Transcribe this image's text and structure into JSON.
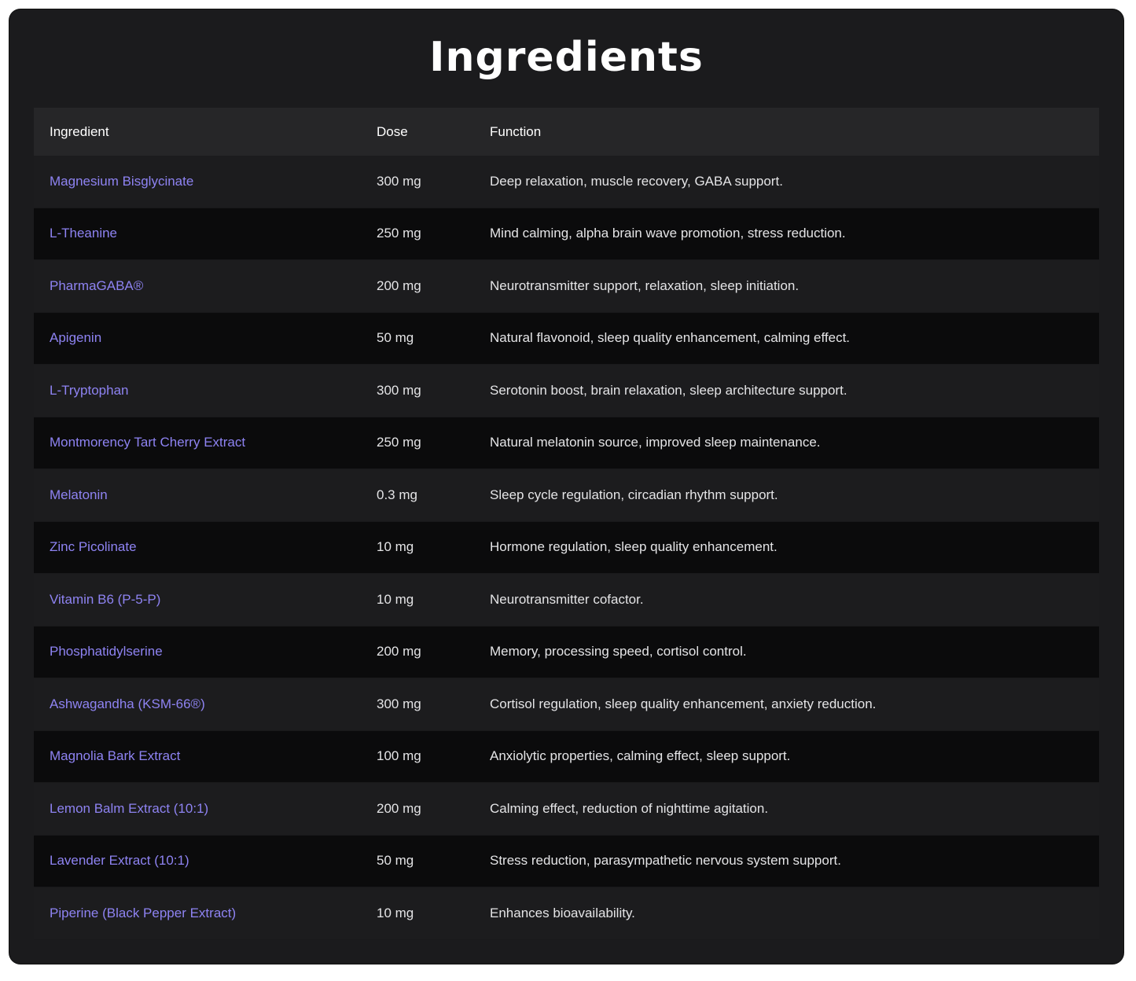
{
  "title": "Ingredients",
  "colors": {
    "card_background": "#1b1b1d",
    "header_background": "#262628",
    "ingredient_link": "#8e83f2",
    "text": "#e4e4e6"
  },
  "table": {
    "headers": [
      "Ingredient",
      "Dose",
      "Function"
    ],
    "rows": [
      {
        "ingredient": "Magnesium Bisglycinate",
        "dose": "300 mg",
        "function": "Deep relaxation, muscle recovery, GABA support."
      },
      {
        "ingredient": "L-Theanine",
        "dose": "250 mg",
        "function": "Mind calming, alpha brain wave promotion, stress reduction."
      },
      {
        "ingredient": "PharmaGABA®",
        "dose": "200 mg",
        "function": "Neurotransmitter support, relaxation, sleep initiation."
      },
      {
        "ingredient": "Apigenin",
        "dose": "50 mg",
        "function": "Natural flavonoid, sleep quality enhancement, calming effect."
      },
      {
        "ingredient": "L-Tryptophan",
        "dose": "300 mg",
        "function": "Serotonin boost, brain relaxation, sleep architecture support."
      },
      {
        "ingredient": "Montmorency Tart Cherry Extract",
        "dose": "250 mg",
        "function": "Natural melatonin source, improved sleep maintenance."
      },
      {
        "ingredient": "Melatonin",
        "dose": "0.3 mg",
        "function": "Sleep cycle regulation, circadian rhythm support."
      },
      {
        "ingredient": "Zinc Picolinate",
        "dose": "10 mg",
        "function": "Hormone regulation, sleep quality enhancement."
      },
      {
        "ingredient": "Vitamin B6 (P-5-P)",
        "dose": "10 mg",
        "function": "Neurotransmitter cofactor."
      },
      {
        "ingredient": "Phosphatidylserine",
        "dose": "200 mg",
        "function": "Memory, processing speed, cortisol control."
      },
      {
        "ingredient": "Ashwagandha (KSM-66®)",
        "dose": "300 mg",
        "function": "Cortisol regulation, sleep quality enhancement, anxiety reduction."
      },
      {
        "ingredient": "Magnolia Bark Extract",
        "dose": "100 mg",
        "function": "Anxiolytic properties, calming effect, sleep support."
      },
      {
        "ingredient": "Lemon Balm Extract (10:1)",
        "dose": "200 mg",
        "function": "Calming effect, reduction of nighttime agitation."
      },
      {
        "ingredient": "Lavender Extract (10:1)",
        "dose": "50 mg",
        "function": "Stress reduction, parasympathetic nervous system support."
      },
      {
        "ingredient": "Piperine (Black Pepper Extract)",
        "dose": "10 mg",
        "function": "Enhances bioavailability."
      }
    ]
  }
}
